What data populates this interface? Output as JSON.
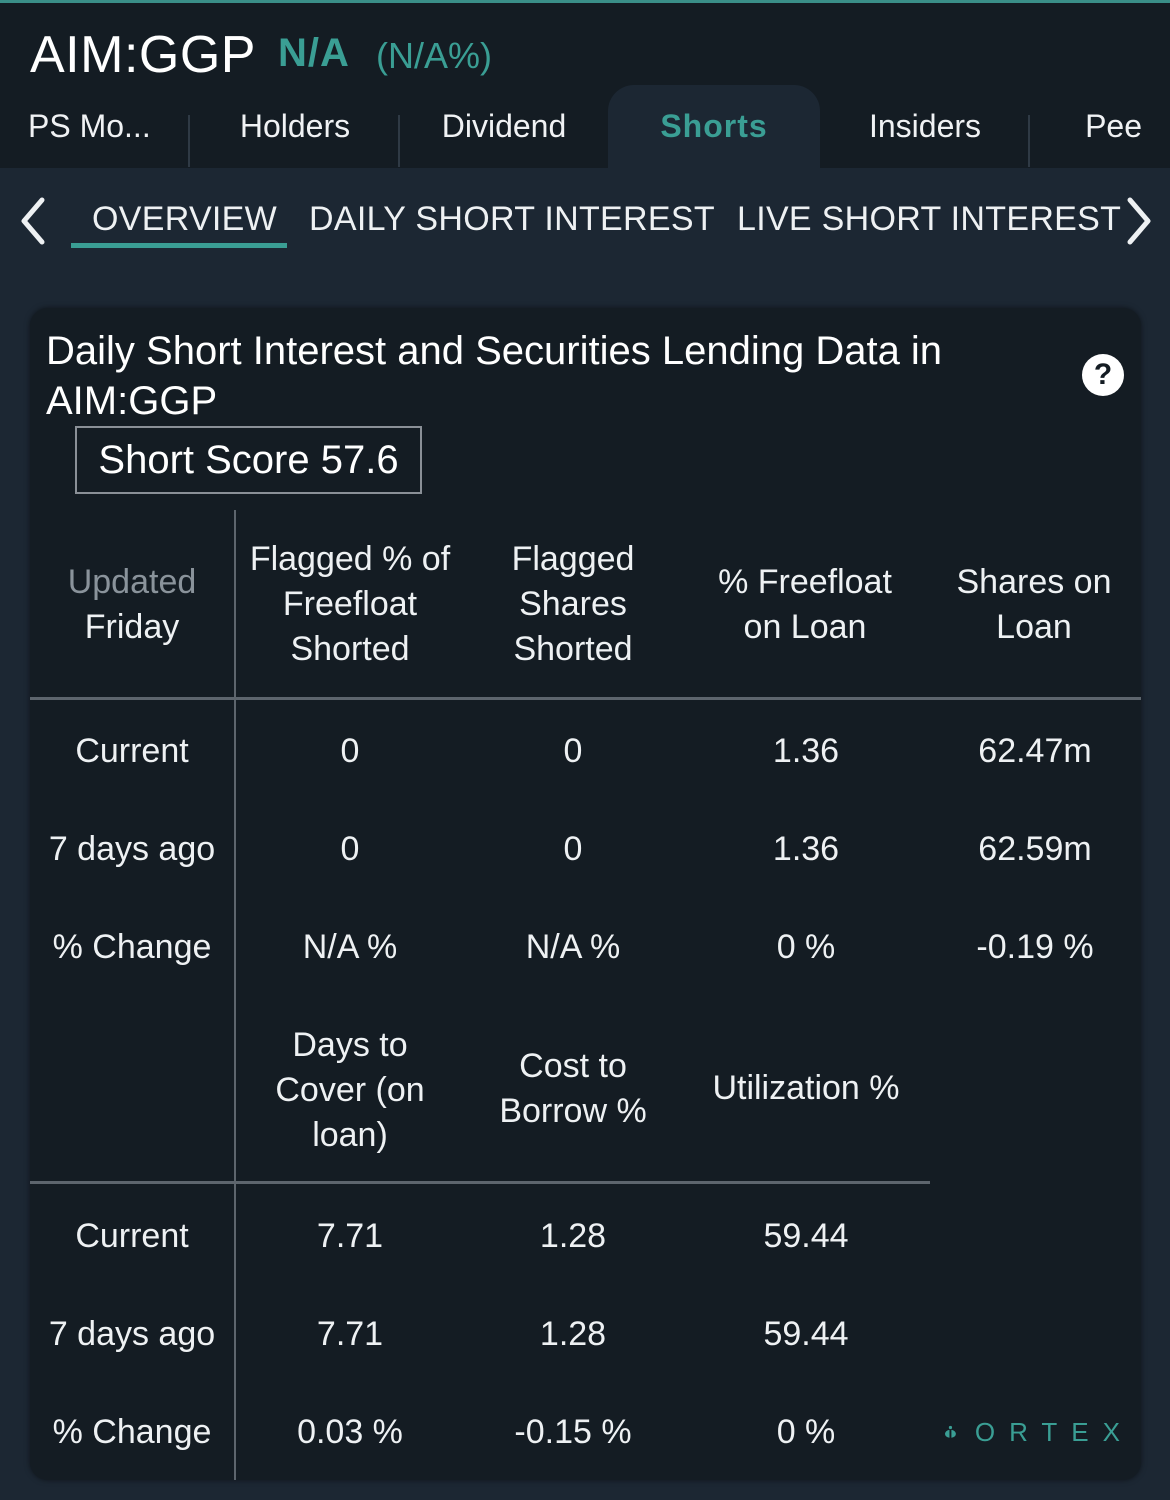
{
  "header": {
    "ticker": "AIM:GGP",
    "price": "N/A",
    "change": "(N/A%)"
  },
  "tabs": [
    {
      "label": "PS Mo..."
    },
    {
      "label": "Holders"
    },
    {
      "label": "Dividend"
    },
    {
      "label": "Shorts"
    },
    {
      "label": "Insiders"
    },
    {
      "label": "Pee"
    }
  ],
  "subnav": {
    "items": [
      {
        "label": "OVERVIEW"
      },
      {
        "label": "DAILY SHORT INTEREST"
      },
      {
        "label": "LIVE SHORT INTEREST"
      }
    ]
  },
  "card": {
    "title": "Daily Short Interest and Securities Lending Data in AIM:GGP",
    "help_label": "?",
    "short_score": "Short Score 57.6"
  },
  "table1": {
    "corner_top": "Updated",
    "corner_bottom": "Friday",
    "headers": [
      "Flagged % of Freefloat Shorted",
      "Flagged Shares Shorted",
      "% Freefloat on Loan",
      "Shares on Loan"
    ],
    "rows": [
      {
        "label": "Current",
        "values": [
          "0",
          "0",
          "1.36",
          "62.47m"
        ]
      },
      {
        "label": "7 days ago",
        "values": [
          "0",
          "0",
          "1.36",
          "62.59m"
        ]
      },
      {
        "label": "% Change",
        "values": [
          "N/A %",
          "N/A %",
          "0 %",
          "-0.19 %"
        ]
      }
    ]
  },
  "table2": {
    "headers": [
      "Days to Cover (on loan)",
      "Cost to Borrow %",
      "Utilization %"
    ],
    "rows": [
      {
        "label": "Current",
        "values": [
          "7.71",
          "1.28",
          "59.44"
        ]
      },
      {
        "label": "7 days ago",
        "values": [
          "7.71",
          "1.28",
          "59.44"
        ]
      },
      {
        "label": "% Change",
        "values": [
          "0.03 %",
          "-0.15 %",
          "0 %"
        ]
      }
    ]
  },
  "branding": {
    "logo_text": "ORTEX"
  },
  "colors": {
    "accent": "#3a9e94",
    "background": "#1c2733",
    "panel": "#141c23"
  }
}
